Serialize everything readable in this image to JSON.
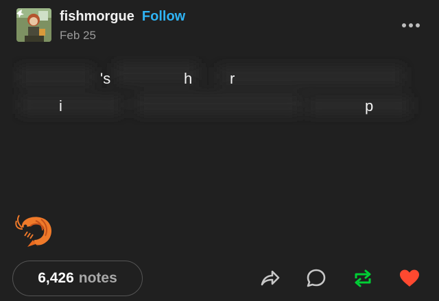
{
  "post": {
    "username": "fishmorgue",
    "follow_label": "Follow",
    "date": "Feb 25",
    "more_icon": "more-horizontal-icon"
  },
  "content": {
    "visible_fragments": [
      "'s",
      "h",
      "r",
      "i",
      "p"
    ],
    "emoji": "shrimp"
  },
  "footer": {
    "notes_count": "6,426",
    "notes_label": "notes",
    "actions": [
      "share-icon",
      "reply-icon",
      "reblog-icon",
      "like-icon"
    ]
  },
  "colors": {
    "background": "#202020",
    "follow": "#2fb4f5",
    "reblog": "#00cf35",
    "like": "#ff4930",
    "muted": "#9b9b9b"
  }
}
